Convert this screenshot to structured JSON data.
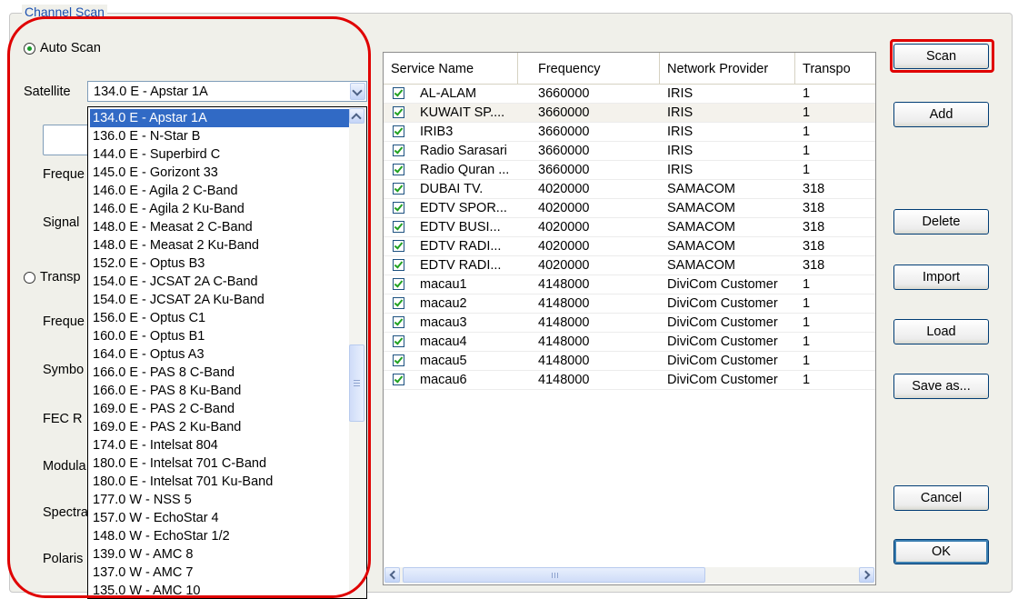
{
  "group_title": "Channel Scan",
  "auto_scan": {
    "label": "Auto Scan",
    "selected": true
  },
  "satellite": {
    "label": "Satellite",
    "selected": "134.0 E - Apstar 1A",
    "options": [
      "134.0 E - Apstar 1A",
      "136.0 E - N-Star B",
      "144.0 E - Superbird C",
      "145.0 E - Gorizont 33",
      "146.0 E - Agila 2 C-Band",
      "146.0 E - Agila 2 Ku-Band",
      "148.0 E - Measat 2 C-Band",
      "148.0 E - Measat 2 Ku-Band",
      "152.0 E - Optus B3",
      "154.0 E - JCSAT 2A C-Band",
      "154.0 E - JCSAT 2A Ku-Band",
      "156.0 E - Optus C1",
      "160.0 E - Optus B1",
      "164.0 E - Optus A3",
      "166.0 E - PAS 8 C-Band",
      "166.0 E - PAS 8 Ku-Band",
      "169.0 E - PAS 2 C-Band",
      "169.0 E - PAS 2 Ku-Band",
      "174.0 E - Intelsat 804",
      "180.0 E - Intelsat 701 C-Band",
      "180.0 E - Intelsat 701 Ku-Band",
      "177.0 W - NSS 5",
      "157.0 W - EchoStar 4",
      "148.0 W - EchoStar 1/2",
      "139.0 W - AMC 8",
      "137.0 W - AMC 7",
      "135.0 W - AMC 10"
    ]
  },
  "left_labels": [
    "Freque",
    "Signal",
    "Transp",
    "Freque",
    "Symbo",
    "FEC R",
    "Modula",
    "Spectra",
    "Polaris"
  ],
  "table": {
    "headers": [
      "Service Name",
      "Frequency",
      "Network Provider",
      "Transpo"
    ],
    "rows": [
      [
        "AL-ALAM",
        "3660000",
        "IRIS",
        "1"
      ],
      [
        "KUWAIT SP....",
        "3660000",
        "IRIS",
        "1"
      ],
      [
        "IRIB3",
        "3660000",
        "IRIS",
        "1"
      ],
      [
        "Radio Sarasari",
        "3660000",
        "IRIS",
        "1"
      ],
      [
        "Radio Quran ...",
        "3660000",
        "IRIS",
        "1"
      ],
      [
        "DUBAI TV.",
        "4020000",
        "SAMACOM",
        "318"
      ],
      [
        "EDTV SPOR...",
        "4020000",
        "SAMACOM",
        "318"
      ],
      [
        "EDTV BUSI...",
        "4020000",
        "SAMACOM",
        "318"
      ],
      [
        "EDTV RADI...",
        "4020000",
        "SAMACOM",
        "318"
      ],
      [
        "EDTV RADI...",
        "4020000",
        "SAMACOM",
        "318"
      ],
      [
        "macau1",
        "4148000",
        "DiviCom Customer",
        "1"
      ],
      [
        "macau2",
        "4148000",
        "DiviCom Customer",
        "1"
      ],
      [
        "macau3",
        "4148000",
        "DiviCom Customer",
        "1"
      ],
      [
        "macau4",
        "4148000",
        "DiviCom Customer",
        "1"
      ],
      [
        "macau5",
        "4148000",
        "DiviCom Customer",
        "1"
      ],
      [
        "macau6",
        "4148000",
        "DiviCom Customer",
        "1"
      ]
    ]
  },
  "buttons": {
    "scan": "Scan",
    "add": "Add",
    "delete": "Delete",
    "import": "Import",
    "load": "Load",
    "save_as": "Save as...",
    "cancel": "Cancel",
    "ok": "OK"
  },
  "colors": {
    "highlight": "#e00000",
    "selection": "#316ac5",
    "legend": "#1b4fb0"
  }
}
